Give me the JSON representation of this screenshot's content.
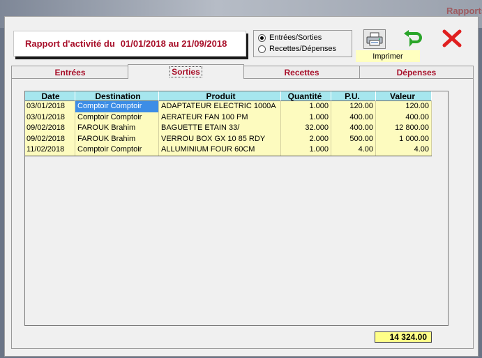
{
  "background": {
    "title": "Rapports"
  },
  "header": {
    "report_label": "Rapport d'activité du",
    "report_dates": "01/01/2018 au 21/09/2018"
  },
  "mode": {
    "options": [
      {
        "label": "Entrées/Sorties",
        "checked": true
      },
      {
        "label": "Recettes/Dépenses",
        "checked": false
      }
    ]
  },
  "toolbar": {
    "print_label": "Imprimer",
    "print_icon": "printer-icon",
    "undo_icon": "undo-arrow-icon",
    "close_icon": "close-icon"
  },
  "tabs": [
    {
      "label": "Entrées"
    },
    {
      "label": "Sorties",
      "active": true
    },
    {
      "label": "Recettes"
    },
    {
      "label": "Dépenses"
    }
  ],
  "table": {
    "columns": [
      "Date",
      "Destination",
      "Produit",
      "Quantité",
      "P.U.",
      "Valeur"
    ],
    "rows": [
      {
        "date": "03/01/2018",
        "destination": "Comptoir Comptoir",
        "produit": "ADAPTATEUR ELECTRIC 1000A",
        "quantite": "1.000",
        "pu": "120.00",
        "valeur": "120.00"
      },
      {
        "date": "03/01/2018",
        "destination": "Comptoir Comptoir",
        "produit": "AERATEUR FAN 100 PM",
        "quantite": "1.000",
        "pu": "400.00",
        "valeur": "400.00"
      },
      {
        "date": "09/02/2018",
        "destination": "FAROUK Brahim",
        "produit": "BAGUETTE ETAIN 33/",
        "quantite": "32.000",
        "pu": "400.00",
        "valeur": "12 800.00"
      },
      {
        "date": "09/02/2018",
        "destination": "FAROUK Brahim",
        "produit": "VERROU BOX GX 10 85 RDY",
        "quantite": "2.000",
        "pu": "500.00",
        "valeur": "1 000.00"
      },
      {
        "date": "11/02/2018",
        "destination": "Comptoir Comptoir",
        "produit": "ALLUMINIUM FOUR 60CM",
        "quantite": "1.000",
        "pu": "4.00",
        "valeur": "4.00"
      }
    ]
  },
  "total": "14 324.00",
  "colors": {
    "accent": "#a8102a",
    "header_bg": "#a6e6ee",
    "row_bg": "#fdfbbf",
    "selection": "#3c8de6"
  }
}
